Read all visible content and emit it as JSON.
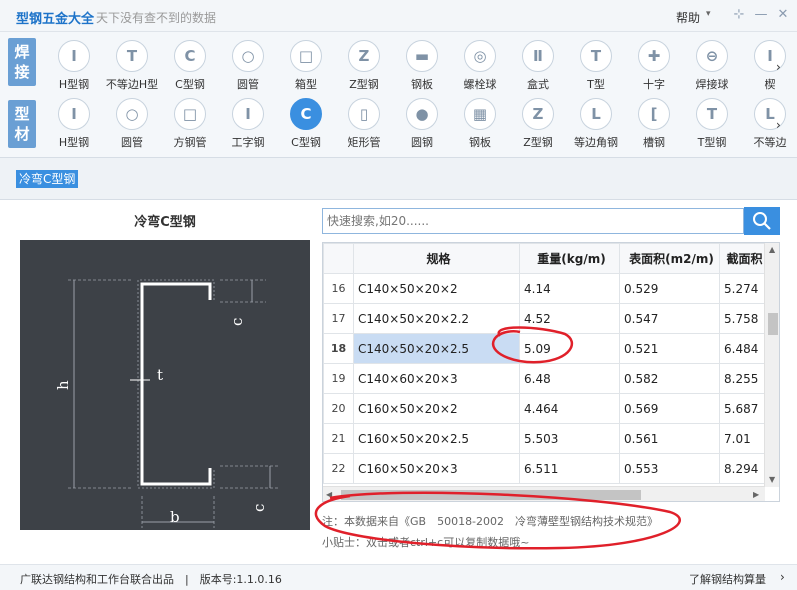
{
  "app": {
    "title": "型钢五金大全",
    "slogan": "天下没有查不到的数据",
    "help_label": "帮助",
    "help_caret": "▾",
    "pin_icon": "⊹",
    "minimize_icon": "—",
    "close_icon": "✕"
  },
  "toolbar": {
    "categories": [
      {
        "line1": "焊",
        "line2": "接"
      },
      {
        "line1": "型",
        "line2": "材"
      }
    ],
    "row1": [
      {
        "label": "H型钢",
        "glyph": "I"
      },
      {
        "label": "不等边H型",
        "glyph": "T"
      },
      {
        "label": "C型钢",
        "glyph": "C"
      },
      {
        "label": "圆管",
        "glyph": "○"
      },
      {
        "label": "箱型",
        "glyph": "□"
      },
      {
        "label": "Z型钢",
        "glyph": "Z"
      },
      {
        "label": "钢板",
        "glyph": "▬"
      },
      {
        "label": "螺栓球",
        "glyph": "◎"
      },
      {
        "label": "盒式",
        "glyph": "Ⅱ"
      },
      {
        "label": "T型",
        "glyph": "T"
      },
      {
        "label": "十字",
        "glyph": "✚"
      },
      {
        "label": "焊接球",
        "glyph": "⊖"
      },
      {
        "label": "楔",
        "glyph": "I"
      }
    ],
    "row2": [
      {
        "label": "H型钢",
        "glyph": "I"
      },
      {
        "label": "圆管",
        "glyph": "○"
      },
      {
        "label": "方钢管",
        "glyph": "□"
      },
      {
        "label": "工字钢",
        "glyph": "I"
      },
      {
        "label": "C型钢",
        "glyph": "C"
      },
      {
        "label": "矩形管",
        "glyph": "▯"
      },
      {
        "label": "圆钢",
        "glyph": "●"
      },
      {
        "label": "钢板",
        "glyph": "▦"
      },
      {
        "label": "Z型钢",
        "glyph": "Z"
      },
      {
        "label": "等边角钢",
        "glyph": "L"
      },
      {
        "label": "槽钢",
        "glyph": "["
      },
      {
        "label": "T型钢",
        "glyph": "T"
      },
      {
        "label": "不等边",
        "glyph": "L"
      }
    ],
    "more_arrow": "›"
  },
  "breadcrumb": "冷弯C型钢",
  "figure": {
    "title": "冷弯C型钢",
    "labels": {
      "h": "h",
      "t": "t",
      "b": "b",
      "c_top": "c",
      "c_bottom": "c"
    }
  },
  "search": {
    "placeholder": "快速搜索,如20......",
    "icon": "search-icon"
  },
  "table": {
    "columns": [
      "",
      "规格",
      "重量(kg/m)",
      "表面积(m2/m)",
      "截面积"
    ],
    "rows": [
      {
        "idx": "16",
        "spec": "C140×50×20×2",
        "weight": "4.14",
        "area_surface": "0.529",
        "area_section": "5.274"
      },
      {
        "idx": "17",
        "spec": "C140×50×20×2.2",
        "weight": "4.52",
        "area_surface": "0.547",
        "area_section": "5.758"
      },
      {
        "idx": "18",
        "spec": "C140×50×20×2.5",
        "weight": "5.09",
        "area_surface": "0.521",
        "area_section": "6.484"
      },
      {
        "idx": "19",
        "spec": "C140×60×20×3",
        "weight": "6.48",
        "area_surface": "0.582",
        "area_section": "8.255"
      },
      {
        "idx": "20",
        "spec": "C160×50×20×2",
        "weight": "4.464",
        "area_surface": "0.569",
        "area_section": "5.687"
      },
      {
        "idx": "21",
        "spec": "C160×50×20×2.5",
        "weight": "5.503",
        "area_surface": "0.561",
        "area_section": "7.01"
      },
      {
        "idx": "22",
        "spec": "C160×50×20×3",
        "weight": "6.511",
        "area_surface": "0.553",
        "area_section": "8.294"
      }
    ],
    "selected_index": "18"
  },
  "notes": {
    "source": "注：本数据来自《GB　50018-2002　冷弯薄壁型钢结构技术规范》",
    "tip": "小贴士：双击或者ctrl+c可以复制数据哦~"
  },
  "status": {
    "left": "广联达钢结构和工作台联合出品　|　版本号:1.1.0.16",
    "right": "了解钢结构算量",
    "right_arrow": "›"
  },
  "colors": {
    "accent": "#3a8fe0",
    "annotation": "#e0202a",
    "diagram_bg": "#3d4147"
  }
}
